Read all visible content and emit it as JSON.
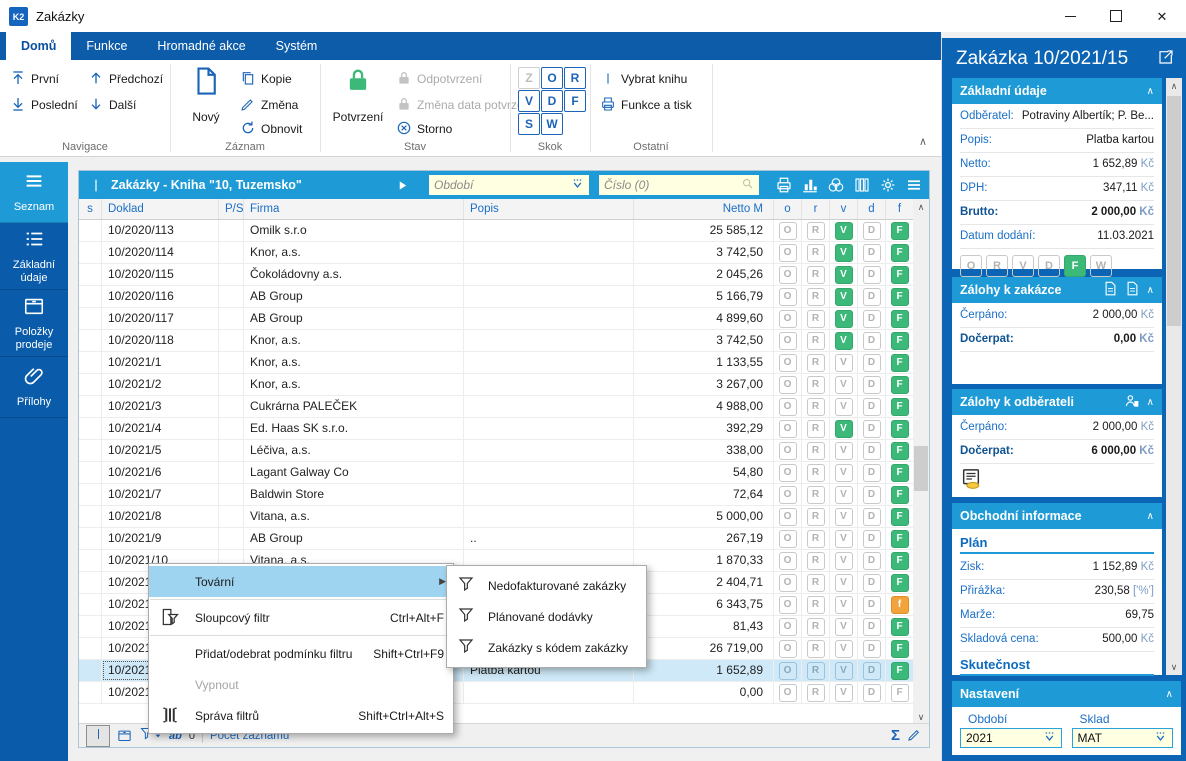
{
  "window": {
    "title": "Zakázky",
    "logo": "K2"
  },
  "tabs": [
    {
      "label": "Domů",
      "active": true
    },
    {
      "label": "Funkce"
    },
    {
      "label": "Hromadné akce"
    },
    {
      "label": "Systém"
    }
  ],
  "ribbon": {
    "navigace": {
      "label": "Navigace",
      "first": "První",
      "last": "Poslední",
      "prev": "Předchozí",
      "next": "Další"
    },
    "zaznam": {
      "label": "Záznam",
      "new": "Nový",
      "copy": "Kopie",
      "change": "Změna",
      "refresh": "Obnovit"
    },
    "stav": {
      "label": "Stav",
      "confirm": "Potvrzení",
      "unconfirm": "Odpotvrzení",
      "change_date": "Změna data potvrzení",
      "cancel": "Storno"
    },
    "skok": {
      "label": "Skok",
      "letters": [
        {
          "ch": "Z",
          "disabled": true
        },
        {
          "ch": "O"
        },
        {
          "ch": "R"
        },
        {
          "ch": "V"
        },
        {
          "ch": "D"
        },
        {
          "ch": "F"
        },
        {
          "ch": "S"
        },
        {
          "ch": "W"
        }
      ]
    },
    "ostatni": {
      "label": "Ostatní",
      "select_book": "Vybrat knihu",
      "func_print": "Funkce a tisk"
    }
  },
  "sidebar": {
    "items": [
      {
        "label": "Seznam",
        "icon": "hamb",
        "active": true
      },
      {
        "label": "Základní údaje",
        "icon": "list"
      },
      {
        "label": "Položky prodeje",
        "icon": "box"
      },
      {
        "label": "Přílohy",
        "icon": "clip"
      }
    ]
  },
  "browse": {
    "title": "Zakázky - Kniha \"10, Tuzemsko\"",
    "period_placeholder": "Období",
    "number_placeholder": "Číslo (0)",
    "columns": [
      "s",
      "Doklad",
      "P/S",
      "Firma",
      "Popis",
      "Netto M",
      "o",
      "r",
      "v",
      "d",
      "f"
    ],
    "rows": [
      {
        "dk": "10/2020/113",
        "fa": "Omilk s.r.o",
        "pp": "",
        "nt": "25 585,12",
        "v": 1,
        "f": 1
      },
      {
        "dk": "10/2020/114",
        "fa": "Knor, a.s.",
        "pp": "",
        "nt": "3 742,50",
        "v": 1,
        "f": 1
      },
      {
        "dk": "10/2020/115",
        "fa": "Čokoládovny a.s.",
        "pp": "",
        "nt": "2 045,26",
        "v": 1,
        "f": 1
      },
      {
        "dk": "10/2020/116",
        "fa": "AB Group",
        "pp": "",
        "nt": "5 166,79",
        "v": 1,
        "f": 1
      },
      {
        "dk": "10/2020/117",
        "fa": "AB Group",
        "pp": "",
        "nt": "4 899,60",
        "v": 1,
        "f": 1
      },
      {
        "dk": "10/2020/118",
        "fa": "Knor, a.s.",
        "pp": "",
        "nt": "3 742,50",
        "v": 1,
        "f": 1
      },
      {
        "dk": "10/2021/1",
        "fa": "Knor, a.s.",
        "pp": "",
        "nt": "1 133,55",
        "v": 0,
        "f": 1
      },
      {
        "dk": "10/2021/2",
        "fa": "Knor, a.s.",
        "pp": "",
        "nt": "3 267,00",
        "v": 0,
        "f": 1
      },
      {
        "dk": "10/2021/3",
        "fa": "Cukrárna PALEČEK",
        "pp": "",
        "nt": "4 988,00",
        "v": 0,
        "f": 1
      },
      {
        "dk": "10/2021/4",
        "fa": "Ed. Haas SK s.r.o.",
        "pp": "",
        "nt": "392,29",
        "v": 1,
        "f": 1
      },
      {
        "dk": "10/2021/5",
        "fa": "Léčiva, a.s.",
        "pp": "",
        "nt": "338,00",
        "v": 0,
        "f": 1
      },
      {
        "dk": "10/2021/6",
        "fa": "Lagant Galway Co",
        "pp": "",
        "nt": "54,80",
        "v": 0,
        "f": 1
      },
      {
        "dk": "10/2021/7",
        "fa": "Baldwin Store",
        "pp": "",
        "nt": "72,64",
        "v": 0,
        "f": 1
      },
      {
        "dk": "10/2021/8",
        "fa": "Vitana, a.s.",
        "pp": "",
        "nt": "5 000,00",
        "v": 0,
        "f": 1
      },
      {
        "dk": "10/2021/9",
        "fa": "AB Group",
        "pp": "..",
        "nt": "267,19",
        "v": 0,
        "f": 1
      },
      {
        "dk": "10/2021/10",
        "fa": "Vitana, a.s.",
        "pp": "",
        "nt": "1 870,33",
        "v": 0,
        "f": 1
      },
      {
        "dk": "10/2021/11",
        "fa": "",
        "pp": "",
        "nt": "2 404,71",
        "v": 0,
        "f": 1
      },
      {
        "dk": "10/2021/12",
        "fa": "",
        "pp": "",
        "nt": "6 343,75",
        "v": 0,
        "f": 2
      },
      {
        "dk": "10/2021/13",
        "fa": "",
        "pp": "",
        "nt": "81,43",
        "v": 0,
        "f": 1
      },
      {
        "dk": "10/2021/14",
        "fa": "",
        "pp": "",
        "nt": "26 719,00",
        "v": 0,
        "f": 1
      },
      {
        "dk": "10/2021/15",
        "fa": "",
        "pp": "Platba kartou",
        "nt": "1 652,89",
        "v": 0,
        "f": 1,
        "sel": true
      },
      {
        "dk": "10/2021/16",
        "fa": "",
        "pp": "",
        "nt": "0,00",
        "v": 0,
        "f": 0
      }
    ],
    "footer": {
      "ab_label": "ab",
      "count_value": "0",
      "count_label": "Počet záznamů"
    }
  },
  "menu": {
    "items": [
      {
        "label": "Tovární",
        "submenu": true,
        "highlight": true
      },
      {
        "sep": true
      },
      {
        "label": "Sloupcový filtr",
        "shortcut": "Ctrl+Alt+F",
        "icon": "colfilter"
      },
      {
        "sep": true
      },
      {
        "label": "Přidat/odebrat podmínku filtru",
        "shortcut": "Shift+Ctrl+F9"
      },
      {
        "label": "Vypnout",
        "disabled": true
      },
      {
        "label": "Správa filtrů",
        "shortcut": "Shift+Ctrl+Alt+S",
        "icon": "filtermgr"
      }
    ],
    "submenu": [
      "Nedofakturované zakázky",
      "Plánované dodávky",
      "Zakázky s kódem zakázky"
    ]
  },
  "detail": {
    "title": "Zakázka 10/2021/15",
    "basic": {
      "title": "Základní údaje",
      "rows": [
        {
          "label": "Odběratel:",
          "value": "Potraviny Albertík; P. Be..."
        },
        {
          "label": "Popis:",
          "value": "Platba kartou"
        },
        {
          "label": "Netto:",
          "value": "1 652,89",
          "suffix": "Kč"
        },
        {
          "label": "DPH:",
          "value": "347,11",
          "suffix": "Kč"
        },
        {
          "label": "Brutto:",
          "value": "2 000,00",
          "suffix": "Kč",
          "bold": true
        },
        {
          "label": "Datum dodání:",
          "value": "11.03.2021"
        }
      ],
      "badges": [
        [
          "O",
          0
        ],
        [
          "R",
          0
        ],
        [
          "V",
          0
        ],
        [
          "D",
          0
        ],
        [
          "F",
          1
        ],
        [
          "W",
          0
        ]
      ]
    },
    "advances_order": {
      "title": "Zálohy k zakázce",
      "rows": [
        {
          "label": "Čerpáno:",
          "value": "2 000,00",
          "suffix": "Kč"
        },
        {
          "label": "Dočerpat:",
          "value": "0,00",
          "suffix": "Kč",
          "bold": true
        }
      ]
    },
    "advances_customer": {
      "title": "Zálohy k odběrateli",
      "rows": [
        {
          "label": "Čerpáno:",
          "value": "2 000,00",
          "suffix": "Kč"
        },
        {
          "label": "Dočerpat:",
          "value": "6 000,00",
          "suffix": "Kč",
          "bold": true
        }
      ]
    },
    "business": {
      "title": "Obchodní informace",
      "plan_label": "Plán",
      "fact_label": "Skutečnost",
      "rows": [
        {
          "label": "Zisk:",
          "value": "1 152,89",
          "suffix": "Kč"
        },
        {
          "label": "Přirážka:",
          "value": "230,58",
          "suffix": "['%']"
        },
        {
          "label": "Marže:",
          "value": "69,75"
        },
        {
          "label": "Skladová cena:",
          "value": "500,00",
          "suffix": "Kč"
        }
      ]
    },
    "settings": {
      "title": "Nastavení",
      "period_label": "Období",
      "period_value": "2021",
      "stock_label": "Sklad",
      "stock_value": "MAT"
    }
  },
  "colors": {
    "accent": "#1e9bd7",
    "ribbon_blue": "#0d5caa",
    "panel_blue": "#0c64b4",
    "green": "#3cb878",
    "orange": "#f2a33c",
    "input_yellow": "#ffffe1"
  }
}
